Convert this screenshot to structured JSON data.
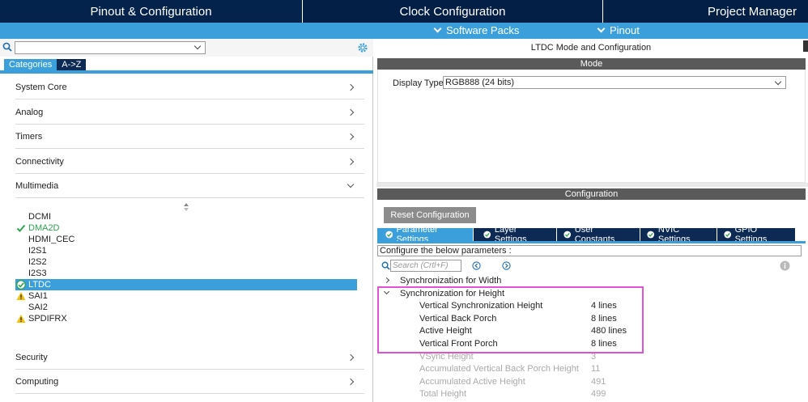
{
  "top_tabs": [
    {
      "label": "Pinout & Configuration"
    },
    {
      "label": "Clock Configuration"
    },
    {
      "label": "Project Manager"
    }
  ],
  "sub_menu": [
    {
      "label": "Software Packs"
    },
    {
      "label": "Pinout"
    }
  ],
  "left": {
    "search_value": "",
    "category_tabs": [
      "Categories",
      "A->Z"
    ],
    "categories_top": [
      "System Core",
      "Analog",
      "Timers",
      "Connectivity",
      "Multimedia"
    ],
    "multimedia_items": [
      {
        "label": "DCMI",
        "status": "none"
      },
      {
        "label": "DMA2D",
        "status": "ok"
      },
      {
        "label": "HDMI_CEC",
        "status": "none"
      },
      {
        "label": "I2S1",
        "status": "none"
      },
      {
        "label": "I2S2",
        "status": "none"
      },
      {
        "label": "I2S3",
        "status": "none"
      },
      {
        "label": "LTDC",
        "status": "ok-selected"
      },
      {
        "label": "SAI1",
        "status": "warning"
      },
      {
        "label": "SAI2",
        "status": "none"
      },
      {
        "label": "SPDIFRX",
        "status": "warning"
      }
    ],
    "categories_bottom": [
      "Security",
      "Computing"
    ]
  },
  "right": {
    "panel_title": "LTDC Mode and Configuration",
    "mode_header": "Mode",
    "display_type_label": "Display Type",
    "display_type_value": "RGB888 (24 bits)",
    "config_header": "Configuration",
    "reset_button": "Reset Configuration",
    "param_tabs": [
      "Parameter Settings",
      "Layer Settings",
      "User Constants",
      "NVIC Settings",
      "GPIO Settings"
    ],
    "configure_text": "Configure the below parameters :",
    "search_placeholder": "Search (Crtl+F)",
    "groups": [
      {
        "label": "Synchronization for Width",
        "expanded": false
      },
      {
        "label": "Synchronization for Height",
        "expanded": true
      }
    ],
    "params": [
      {
        "name": "Vertical Synchronization Height",
        "value": "4 lines",
        "editable": true
      },
      {
        "name": "Vertical Back Porch",
        "value": "8 lines",
        "editable": true
      },
      {
        "name": "Active Height",
        "value": "480 lines",
        "editable": true
      },
      {
        "name": "Vertical Front Porch",
        "value": "8 lines",
        "editable": true
      },
      {
        "name": "VSync Height",
        "value": "3",
        "editable": false
      },
      {
        "name": "Accumulated Vertical Back Porch Height",
        "value": "11",
        "editable": false
      },
      {
        "name": "Accumulated Active Height",
        "value": "491",
        "editable": false
      },
      {
        "name": "Total Height",
        "value": "499",
        "editable": false
      }
    ]
  },
  "colors": {
    "navy": "#031f46",
    "accent_blue": "#3b9fdb",
    "ok_green": "#2ea44f",
    "warning_yellow": "#f2c200",
    "highlight_magenta": "#e052d6"
  }
}
